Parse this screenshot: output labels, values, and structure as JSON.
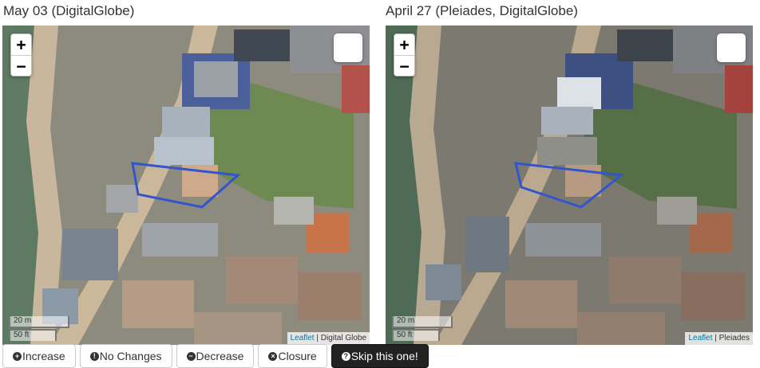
{
  "panels": {
    "left": {
      "title": "May 03 (DigitalGlobe)",
      "scale_m": "20 m",
      "scale_ft": "50 ft",
      "attribution_link": "Leaflet",
      "attribution_text": " | Digital Globe"
    },
    "right": {
      "title": "April 27 (Pleiades, DigitalGlobe)",
      "scale_m": "20 m",
      "scale_ft": "50 ft",
      "attribution_link": "Leaflet",
      "attribution_text": " | Pleiades"
    }
  },
  "zoom": {
    "in": "+",
    "out": "−"
  },
  "buttons": [
    {
      "icon": "+",
      "label": "Increase"
    },
    {
      "icon": "!",
      "label": "No Changes"
    },
    {
      "icon": "−",
      "label": "Decrease"
    },
    {
      "icon": "×",
      "label": "Closure"
    },
    {
      "icon": "?",
      "label": "Skip this one!"
    }
  ],
  "colors": {
    "polygon": "#3355cc",
    "skip_button_bg": "#222222",
    "attribution_link": "#0078a8"
  },
  "icons": [
    "plus-circle-icon",
    "exclamation-circle-icon",
    "minus-circle-icon",
    "times-circle-icon",
    "question-circle-icon",
    "layers-icon"
  ]
}
